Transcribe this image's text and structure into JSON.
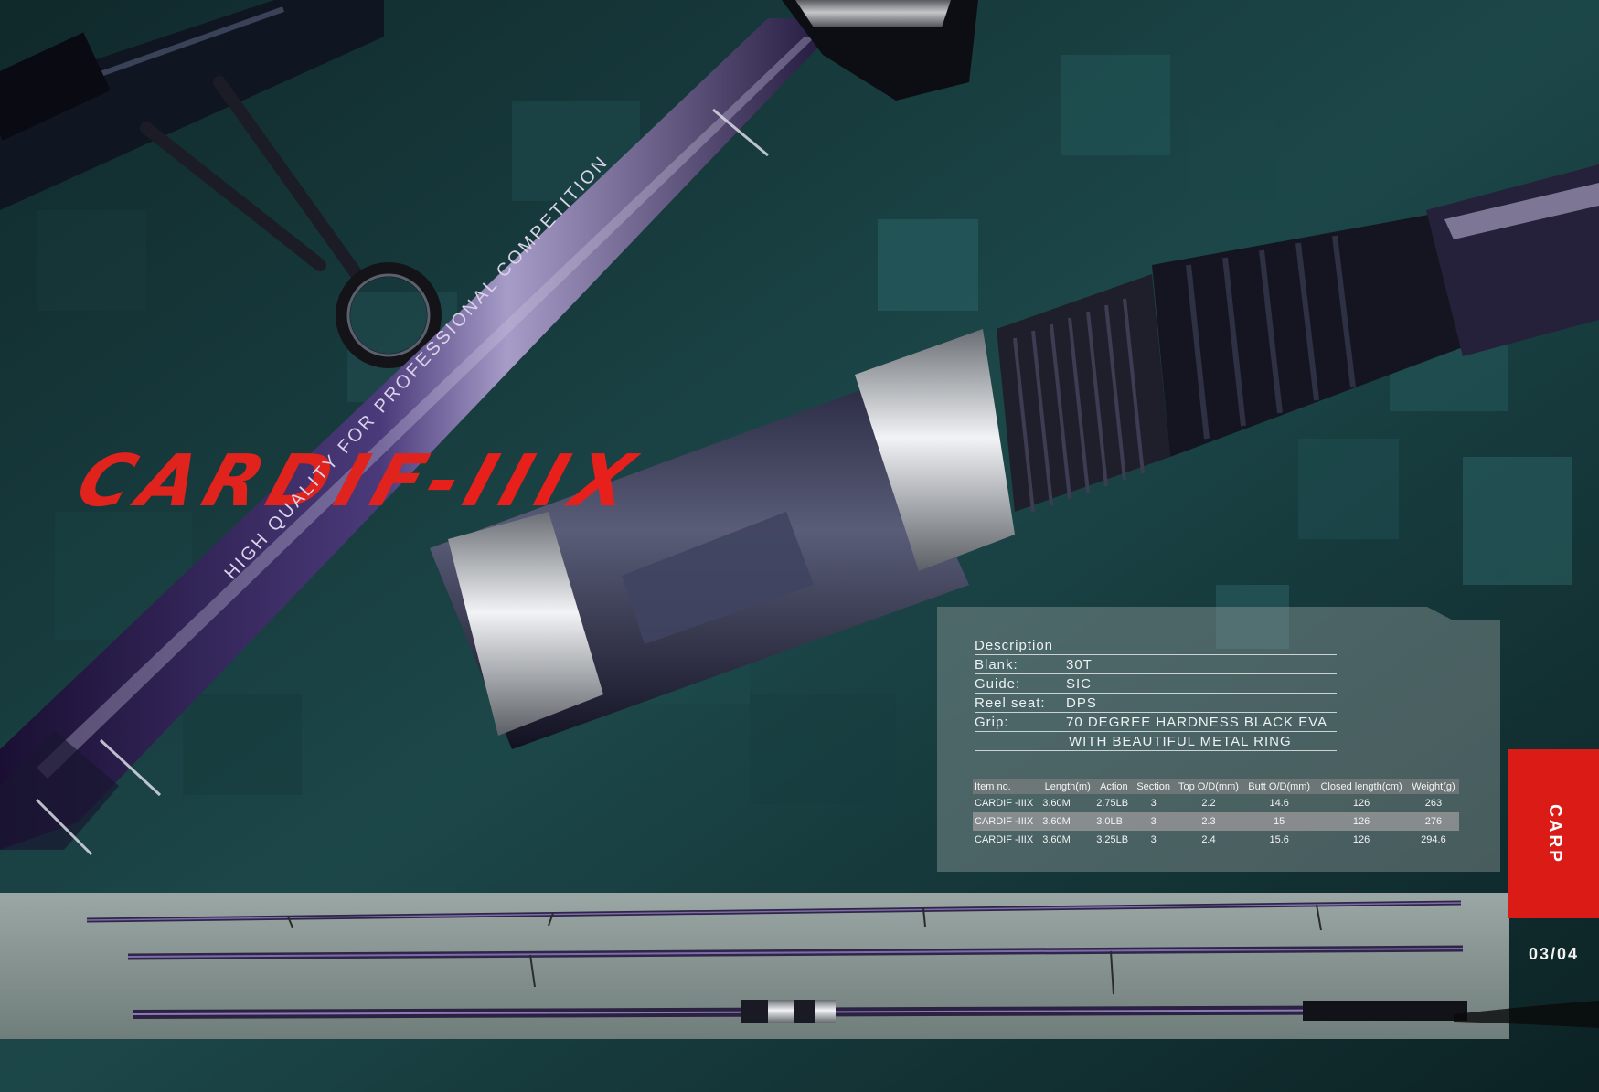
{
  "title": {
    "part1": "CARDIF",
    "part2": "-",
    "part3": "IIIX"
  },
  "rod_text": "HIGH QUALITY FOR PROFESSIONAL COMPETITION",
  "description": {
    "heading": "Description",
    "rows": [
      {
        "label": "Blank:",
        "value": "30T"
      },
      {
        "label": "Guide:",
        "value": "SIC"
      },
      {
        "label": "Reel seat:",
        "value": "DPS"
      },
      {
        "label": "Grip:",
        "value": "70 DEGREE HARDNESS BLACK EVA"
      },
      {
        "label": "",
        "value": "WITH BEAUTIFUL METAL RING"
      }
    ]
  },
  "spec_table": {
    "headers": [
      "Item no.",
      "Length(m)",
      "Action",
      "Section",
      "Top O/D(mm)",
      "Butt O/D(mm)",
      "Closed length(cm)",
      "Weight(g)"
    ],
    "rows": [
      [
        "CARDIF -IIIX",
        "3.60M",
        "2.75LB",
        "3",
        "2.2",
        "14.6",
        "126",
        "263"
      ],
      [
        "CARDIF -IIIX",
        "3.60M",
        "3.0LB",
        "3",
        "2.3",
        "15",
        "126",
        "276"
      ],
      [
        "CARDIF -IIIX",
        "3.60M",
        "3.25LB",
        "3",
        "2.4",
        "15.6",
        "126",
        "294.6"
      ]
    ]
  },
  "category": "CARP",
  "page_number": "03/04",
  "colors": {
    "accent_red": "#da1b16",
    "gold": "#c9a255",
    "background": "#0f2a2c"
  }
}
